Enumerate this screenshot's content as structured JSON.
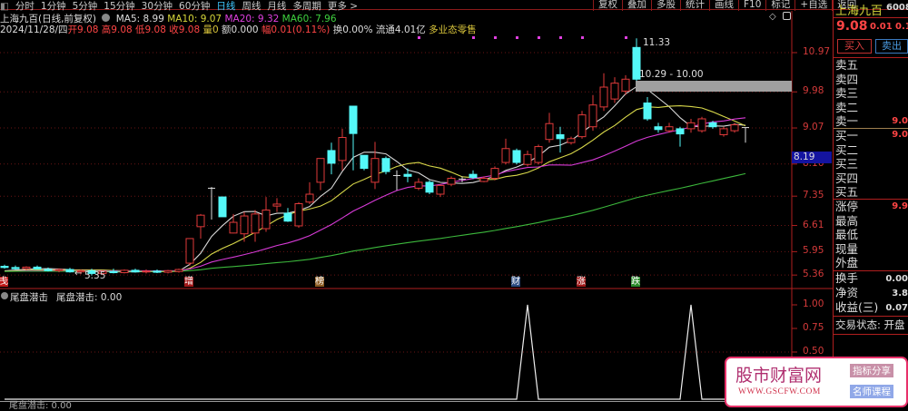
{
  "toolbar": {
    "items": [
      "分时",
      "1分钟",
      "5分钟",
      "15分钟",
      "30分钟",
      "60分钟",
      "日线",
      "周线",
      "月线",
      "多周期",
      "更多 >"
    ],
    "active": "日线",
    "right_buttons": [
      "复权",
      "叠加",
      "多股",
      "统计",
      "画线",
      "F10",
      "标记",
      "+自选",
      "返回"
    ]
  },
  "header": {
    "title": "上海九百(日线,前复权)",
    "ma5": "MA5: 8.99",
    "ma10": "MA10: 9.07",
    "ma20": "MA20: 9.32",
    "ma60": "MA60: 7.96",
    "date": "2024/11/28/四",
    "open": "开9.08",
    "high": "高9.08",
    "low": "低9.08",
    "close": "收9.08",
    "volume": "量0",
    "amount": "额0.000",
    "range": "幅0.01(0.11%)",
    "turnover": "换0.00%",
    "float": "流通4.01亿",
    "sector": "多业态零售"
  },
  "price_axis": [
    "10.97",
    "9.98",
    "9.07",
    "8.16",
    "7.35",
    "6.61",
    "5.95",
    "5.36"
  ],
  "indicator_axis": [
    "1.00",
    "0.75",
    "0.50"
  ],
  "annotations": {
    "high_label": "11.33",
    "low_label": "5.35",
    "range_label": "10.29 - 10.00",
    "cursor_price": "8.19"
  },
  "indicator": {
    "name": "尾盘潜击",
    "value_label": "尾盘潜击: 0.00"
  },
  "markers": [
    {
      "text": "戋",
      "color": "#c01818"
    },
    {
      "text": "增",
      "color": "#a01818"
    },
    {
      "text": "榜",
      "color": "#8a5a20"
    },
    {
      "text": "财",
      "color": "#2a4a80"
    },
    {
      "text": "涨",
      "color": "#a01818"
    },
    {
      "text": "跌",
      "color": "#2a8a2a"
    }
  ],
  "bottom_text": "尾盘潜击: 0.00",
  "right_panel": {
    "name": "上海九百",
    "code": "6008",
    "price": "9.08",
    "change": "0.01",
    "pct": "0.1",
    "buy": "买入",
    "sell": "卖出",
    "asks": [
      "卖五",
      "卖四",
      "卖三",
      "卖二",
      "卖一"
    ],
    "ask1_val": "9.0",
    "bids": [
      "买一",
      "买二",
      "买三",
      "买四",
      "买五"
    ],
    "bid1_val": "9.0",
    "stats": [
      "涨停",
      "最高",
      "最低",
      "现量",
      "外盘"
    ],
    "limit_up_val": "9.9",
    "turnover_label": "换手",
    "turnover_val": "0.00",
    "nav_label": "净资",
    "nav_val": "3.8",
    "eps_label": "收益(三)",
    "eps_val": "0.07",
    "status": "交易状态: 开盘"
  },
  "watermark": {
    "title": "股市财富网",
    "url": "WWW.GSCFW.COM",
    "tag1": "指标分享",
    "tag2": "名师课程"
  },
  "colors": {
    "up": "#e03a3a",
    "down": "#54f8f8",
    "ma5": "#d8d8d8",
    "ma10": "#d8d84a",
    "ma20": "#d63ad6",
    "ma60": "#3cb83c"
  },
  "chart_data": {
    "type": "candlestick",
    "price_range": [
      5.36,
      10.97
    ],
    "ohlc": [
      [
        5.58,
        5.62,
        5.52,
        5.55
      ],
      [
        5.55,
        5.6,
        5.5,
        5.52
      ],
      [
        5.52,
        5.58,
        5.48,
        5.56
      ],
      [
        5.56,
        5.6,
        5.5,
        5.51
      ],
      [
        5.5,
        5.55,
        5.45,
        5.47
      ],
      [
        5.47,
        5.53,
        5.43,
        5.5
      ],
      [
        5.5,
        5.54,
        5.42,
        5.44
      ],
      [
        5.44,
        5.5,
        5.38,
        5.47
      ],
      [
        5.47,
        5.52,
        5.35,
        5.4
      ],
      [
        5.4,
        5.48,
        5.36,
        5.45
      ],
      [
        5.45,
        5.52,
        5.4,
        5.42
      ],
      [
        5.42,
        5.5,
        5.4,
        5.48
      ],
      [
        5.48,
        5.52,
        5.42,
        5.44
      ],
      [
        5.44,
        5.5,
        5.4,
        5.46
      ],
      [
        5.46,
        5.5,
        5.41,
        5.43
      ],
      [
        5.43,
        5.49,
        5.4,
        5.47
      ],
      [
        5.45,
        5.52,
        5.42,
        5.5
      ],
      [
        5.66,
        6.28,
        5.6,
        6.28
      ],
      [
        6.58,
        6.9,
        6.28,
        6.87
      ],
      [
        7.55,
        7.58,
        6.76,
        7.55
      ],
      [
        7.33,
        7.33,
        6.83,
        6.83
      ],
      [
        6.42,
        6.9,
        6.41,
        6.69
      ],
      [
        6.4,
        6.95,
        6.2,
        6.85
      ],
      [
        6.42,
        7.0,
        6.2,
        6.9
      ],
      [
        6.53,
        7.33,
        6.45,
        7.0
      ],
      [
        7.1,
        7.3,
        6.95,
        7.15
      ],
      [
        6.92,
        7.05,
        6.7,
        6.72
      ],
      [
        6.6,
        7.2,
        6.55,
        7.16
      ],
      [
        7.2,
        7.7,
        7.15,
        7.4
      ],
      [
        7.7,
        8.3,
        7.5,
        8.3
      ],
      [
        8.5,
        8.7,
        7.9,
        8.18
      ],
      [
        8.25,
        9.05,
        8.0,
        8.83
      ],
      [
        9.62,
        9.62,
        8.0,
        8.93
      ],
      [
        8.38,
        8.38,
        8.0,
        8.05
      ],
      [
        7.7,
        8.72,
        7.53,
        8.3
      ],
      [
        8.3,
        8.35,
        7.9,
        7.97
      ],
      [
        7.87,
        8.0,
        7.5,
        7.87
      ],
      [
        7.9,
        8.05,
        7.7,
        7.85
      ],
      [
        7.55,
        7.8,
        7.5,
        7.7
      ],
      [
        7.7,
        7.75,
        7.4,
        7.45
      ],
      [
        7.4,
        7.65,
        7.33,
        7.62
      ],
      [
        7.65,
        7.85,
        7.6,
        7.8
      ],
      [
        7.78,
        7.85,
        7.7,
        7.78
      ],
      [
        7.9,
        8.0,
        7.78,
        7.82
      ],
      [
        7.72,
        7.85,
        7.7,
        7.8
      ],
      [
        7.8,
        8.1,
        7.75,
        8.05
      ],
      [
        8.2,
        8.8,
        8.15,
        8.55
      ],
      [
        8.5,
        8.55,
        8.15,
        8.2
      ],
      [
        8.15,
        8.5,
        8.1,
        8.4
      ],
      [
        8.2,
        8.65,
        8.15,
        8.6
      ],
      [
        8.78,
        9.45,
        8.7,
        9.18
      ],
      [
        8.9,
        9.1,
        8.45,
        8.8
      ],
      [
        8.7,
        8.85,
        8.65,
        8.8
      ],
      [
        8.85,
        9.5,
        8.8,
        9.4
      ],
      [
        9.1,
        9.9,
        9.0,
        9.65
      ],
      [
        9.6,
        10.45,
        9.5,
        10.1
      ],
      [
        9.8,
        10.35,
        9.7,
        10.2
      ],
      [
        10.0,
        10.4,
        9.9,
        10.3
      ],
      [
        11.1,
        11.33,
        10.0,
        10.3
      ],
      [
        9.7,
        9.85,
        9.25,
        9.3
      ],
      [
        9.1,
        9.2,
        8.95,
        9.03
      ],
      [
        9.0,
        9.2,
        8.95,
        9.1
      ],
      [
        9.05,
        9.1,
        8.6,
        8.92
      ],
      [
        9.05,
        9.3,
        8.95,
        9.2
      ],
      [
        9.0,
        9.35,
        8.95,
        9.3
      ],
      [
        9.2,
        9.25,
        9.05,
        9.1
      ],
      [
        8.9,
        9.1,
        8.85,
        9.05
      ],
      [
        9.0,
        9.2,
        8.95,
        9.15
      ],
      [
        9.08,
        9.08,
        8.7,
        9.08
      ]
    ],
    "ma_periods": [
      5,
      10,
      20,
      60
    ],
    "marker_indices": [
      0,
      17,
      29,
      47,
      53,
      58
    ],
    "dot_indices": [
      38,
      43,
      45,
      47,
      49,
      51,
      53,
      57
    ],
    "indicator_values_nonzero": {
      "48": 1,
      "63": 1
    },
    "indicator_range": [
      0,
      1
    ]
  }
}
